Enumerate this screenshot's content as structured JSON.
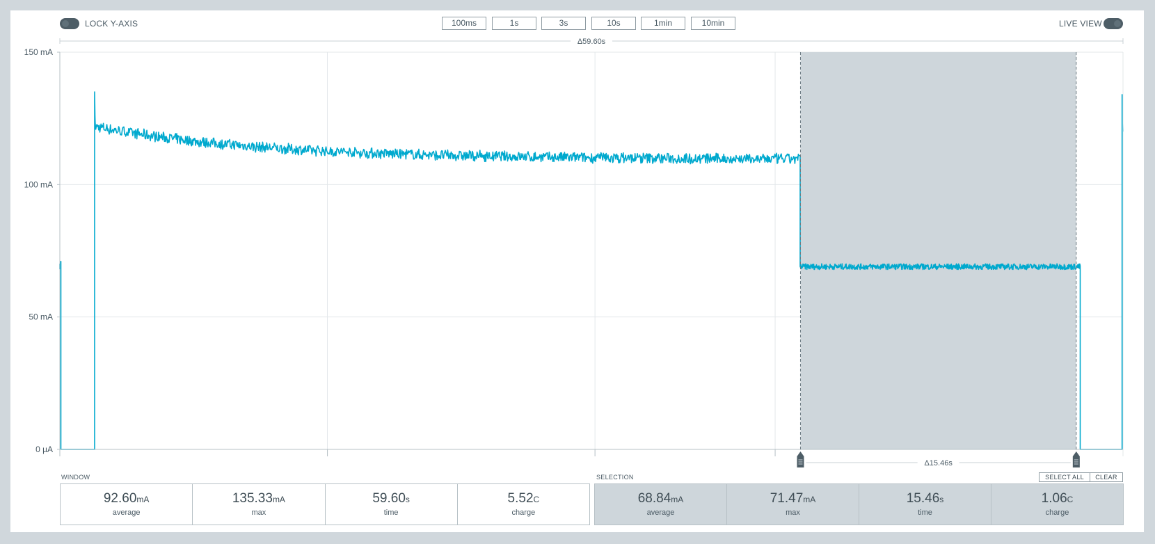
{
  "controls": {
    "lock_y_axis_label": "LOCK Y-AXIS",
    "live_view_label": "LIVE VIEW",
    "zoom_buttons": [
      "100ms",
      "1s",
      "3s",
      "10s",
      "1min",
      "10min"
    ]
  },
  "chart_data": {
    "type": "line",
    "ylabel_ticks": [
      "150 mA",
      "100 mA",
      "50 mA",
      "0 µA"
    ],
    "ylim": [
      0,
      150
    ],
    "xlim": [
      0,
      59.6
    ],
    "x_unit": "s",
    "y_unit": "mA",
    "window_span_label": "Δ59.60s",
    "grid": true,
    "series": [
      {
        "color": "#00a9ce",
        "segments": [
          {
            "t_start": 0.0,
            "t_end": 0.06,
            "level": 70,
            "kind": "flat"
          },
          {
            "t_start": 0.1,
            "t_end": 1.95,
            "level": 0,
            "kind": "flat"
          },
          {
            "t_start": 1.95,
            "t_end": 41.5,
            "kind": "decay",
            "peak": 135,
            "start": 122,
            "end": 109.5
          },
          {
            "t_start": 41.5,
            "t_end": 57.2,
            "level": 69,
            "kind": "flat"
          },
          {
            "t_start": 57.25,
            "t_end": 59.55,
            "level": 0,
            "kind": "flat"
          },
          {
            "t_start": 59.55,
            "t_end": 59.6,
            "kind": "spike",
            "peak": 134,
            "end": 120
          }
        ]
      }
    ],
    "selection": {
      "t_start": 41.52,
      "t_end": 56.98,
      "span_label": "Δ15.46s",
      "color": "#ced6db"
    }
  },
  "window_stats": {
    "label": "WINDOW",
    "items": [
      {
        "value": "92.60",
        "unit": "mA",
        "caption": "average"
      },
      {
        "value": "135.33",
        "unit": "mA",
        "caption": "max"
      },
      {
        "value": "59.60",
        "unit": "s",
        "caption": "time"
      },
      {
        "value": "5.52",
        "unit": "C",
        "caption": "charge"
      }
    ]
  },
  "selection_stats": {
    "label": "SELECTION",
    "select_all_label": "SELECT ALL",
    "clear_label": "CLEAR",
    "items": [
      {
        "value": "68.84",
        "unit": "mA",
        "caption": "average"
      },
      {
        "value": "71.47",
        "unit": "mA",
        "caption": "max"
      },
      {
        "value": "15.46",
        "unit": "s",
        "caption": "time"
      },
      {
        "value": "1.06",
        "unit": "C",
        "caption": "charge"
      }
    ]
  }
}
